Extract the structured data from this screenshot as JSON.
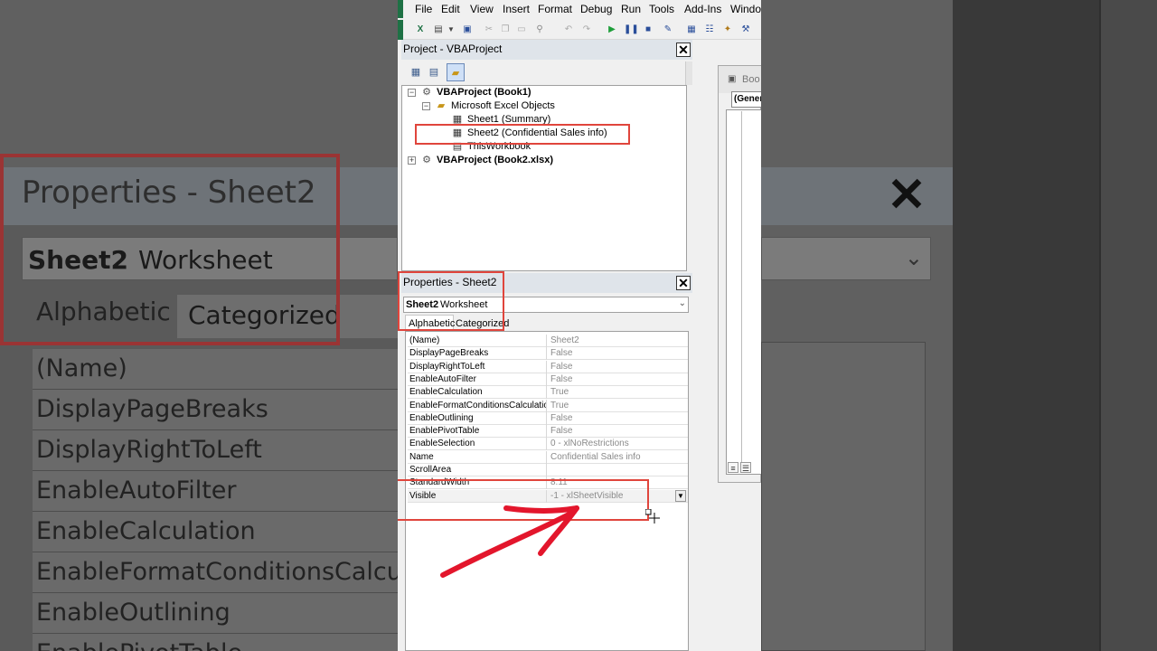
{
  "menu": {
    "items": [
      "File",
      "Edit",
      "View",
      "Insert",
      "Format",
      "Debug",
      "Run",
      "Tools",
      "Add-Ins",
      "Windo"
    ]
  },
  "project_explorer": {
    "title": "Project - VBAProject",
    "close_label": "✕",
    "tree": {
      "project1": "VBAProject (Book1)",
      "folder": "Microsoft Excel Objects",
      "sheet1": "Sheet1 (Summary)",
      "sheet2": "Sheet2 (Confidential Sales info)",
      "workbook": "ThisWorkbook",
      "project2": "VBAProject (Book2.xlsx)"
    }
  },
  "properties": {
    "title": "Properties - Sheet2",
    "close_label": "✕",
    "object_name": "Sheet2",
    "object_type": "Worksheet",
    "tabs": {
      "alphabetic": "Alphabetic",
      "categorized": "Categorized"
    },
    "rows": [
      {
        "key": "(Name)",
        "value": "Sheet2"
      },
      {
        "key": "DisplayPageBreaks",
        "value": "False"
      },
      {
        "key": "DisplayRightToLeft",
        "value": "False"
      },
      {
        "key": "EnableAutoFilter",
        "value": "False"
      },
      {
        "key": "EnableCalculation",
        "value": "True"
      },
      {
        "key": "EnableFormatConditionsCalculation",
        "value": "True"
      },
      {
        "key": "EnableOutlining",
        "value": "False"
      },
      {
        "key": "EnablePivotTable",
        "value": "False"
      },
      {
        "key": "EnableSelection",
        "value": "0 - xlNoRestrictions"
      },
      {
        "key": "Name",
        "value": "Confidential Sales info"
      },
      {
        "key": "ScrollArea",
        "value": ""
      },
      {
        "key": "StandardWidth",
        "value": "8.11"
      },
      {
        "key": "Visible",
        "value": "-1 - xlSheetVisible"
      }
    ]
  },
  "code_window": {
    "title": "Boo",
    "general": "(Gener"
  },
  "background": {
    "title": "Properties - Sheet2",
    "object_name": "Sheet2",
    "object_type": "Worksheet",
    "tab_alphabetic": "Alphabetic",
    "tab_categorized": "Categorized",
    "rows": [
      "(Name)",
      "DisplayPageBreaks",
      "DisplayRightToLeft",
      "EnableAutoFilter",
      "EnableCalculation",
      "EnableFormatConditionsCalcu",
      "EnableOutlining",
      "EnablePivotTable"
    ]
  },
  "colors": {
    "highlight": "#e0453c",
    "arrow": "#e3162c",
    "excel_green": "#1e7145"
  }
}
